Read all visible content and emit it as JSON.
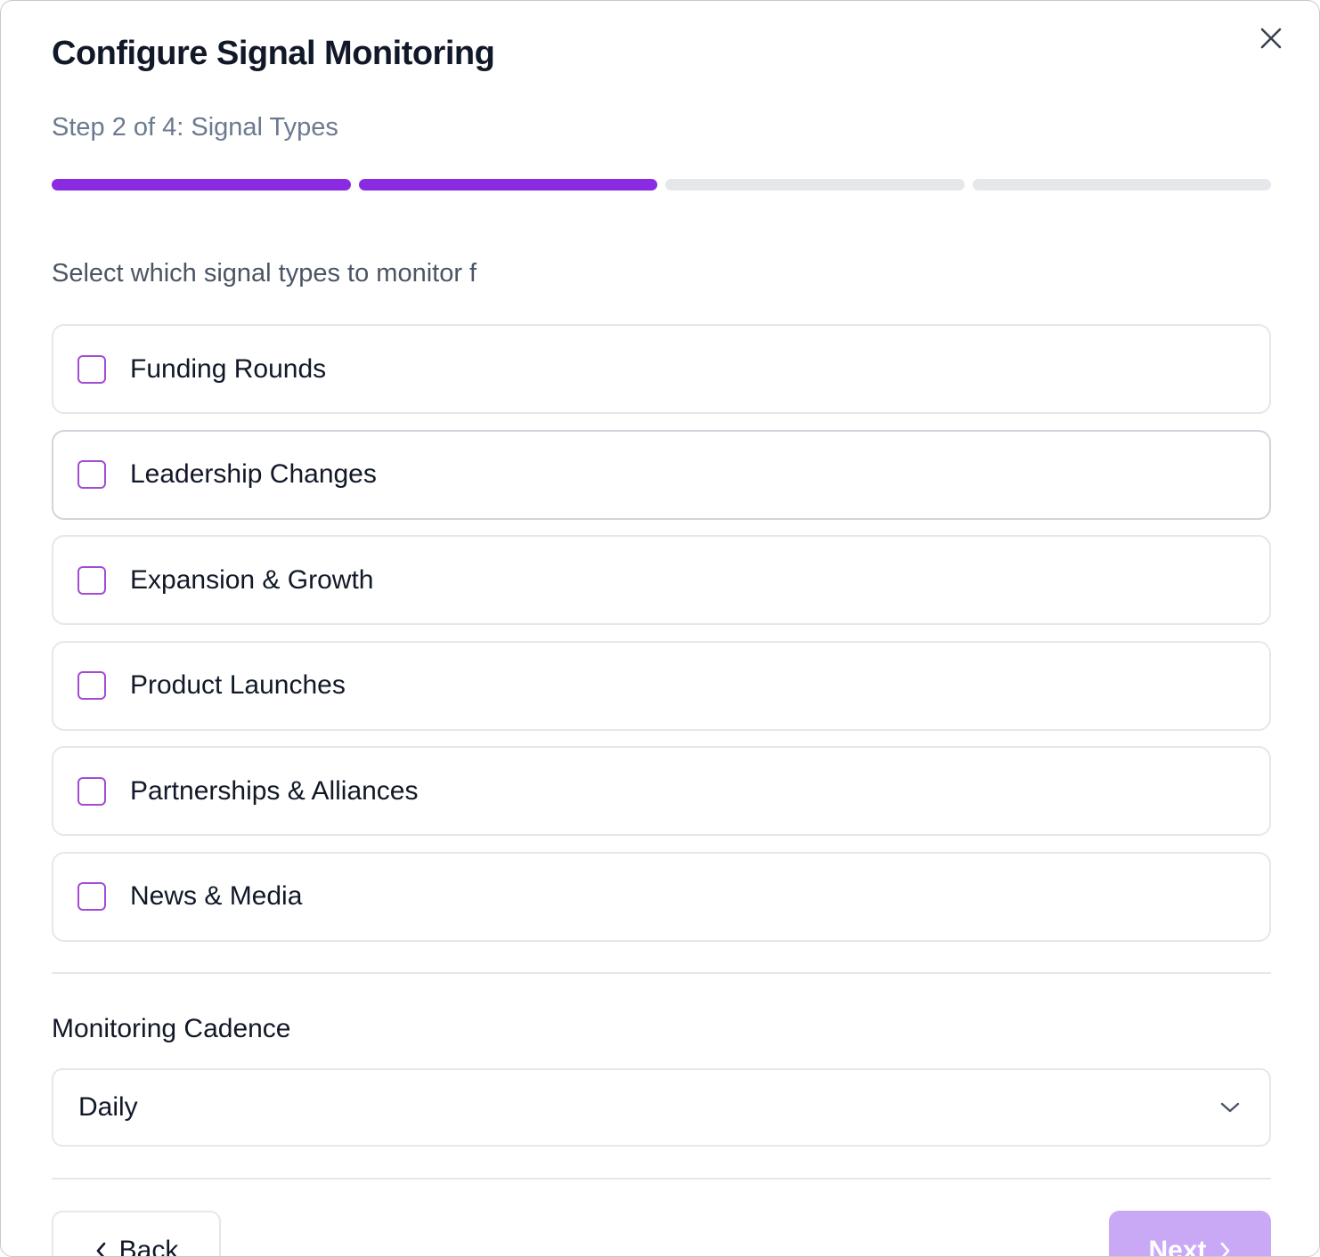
{
  "dialog": {
    "title": "Configure Signal Monitoring",
    "step_text": "Step 2 of 4: Signal Types",
    "progress": {
      "current_step": 2,
      "total_steps": 4
    },
    "accent_color": "#8a2be2"
  },
  "signals": {
    "intro": "Select which signal types to monitor f",
    "options": [
      {
        "label": "Funding Rounds",
        "checked": false
      },
      {
        "label": "Leadership Changes",
        "checked": false
      },
      {
        "label": "Expansion & Growth",
        "checked": false
      },
      {
        "label": "Product Launches",
        "checked": false
      },
      {
        "label": "Partnerships & Alliances",
        "checked": false
      },
      {
        "label": "News & Media",
        "checked": false
      }
    ]
  },
  "cadence": {
    "label": "Monitoring Cadence",
    "selected": "Daily"
  },
  "footer": {
    "back_label": "Back",
    "next_label": "Next"
  },
  "icons": {
    "close": "close-icon",
    "select": "chevron-down-icon",
    "back": "chevron-left-icon",
    "next": "chevron-right-icon"
  }
}
